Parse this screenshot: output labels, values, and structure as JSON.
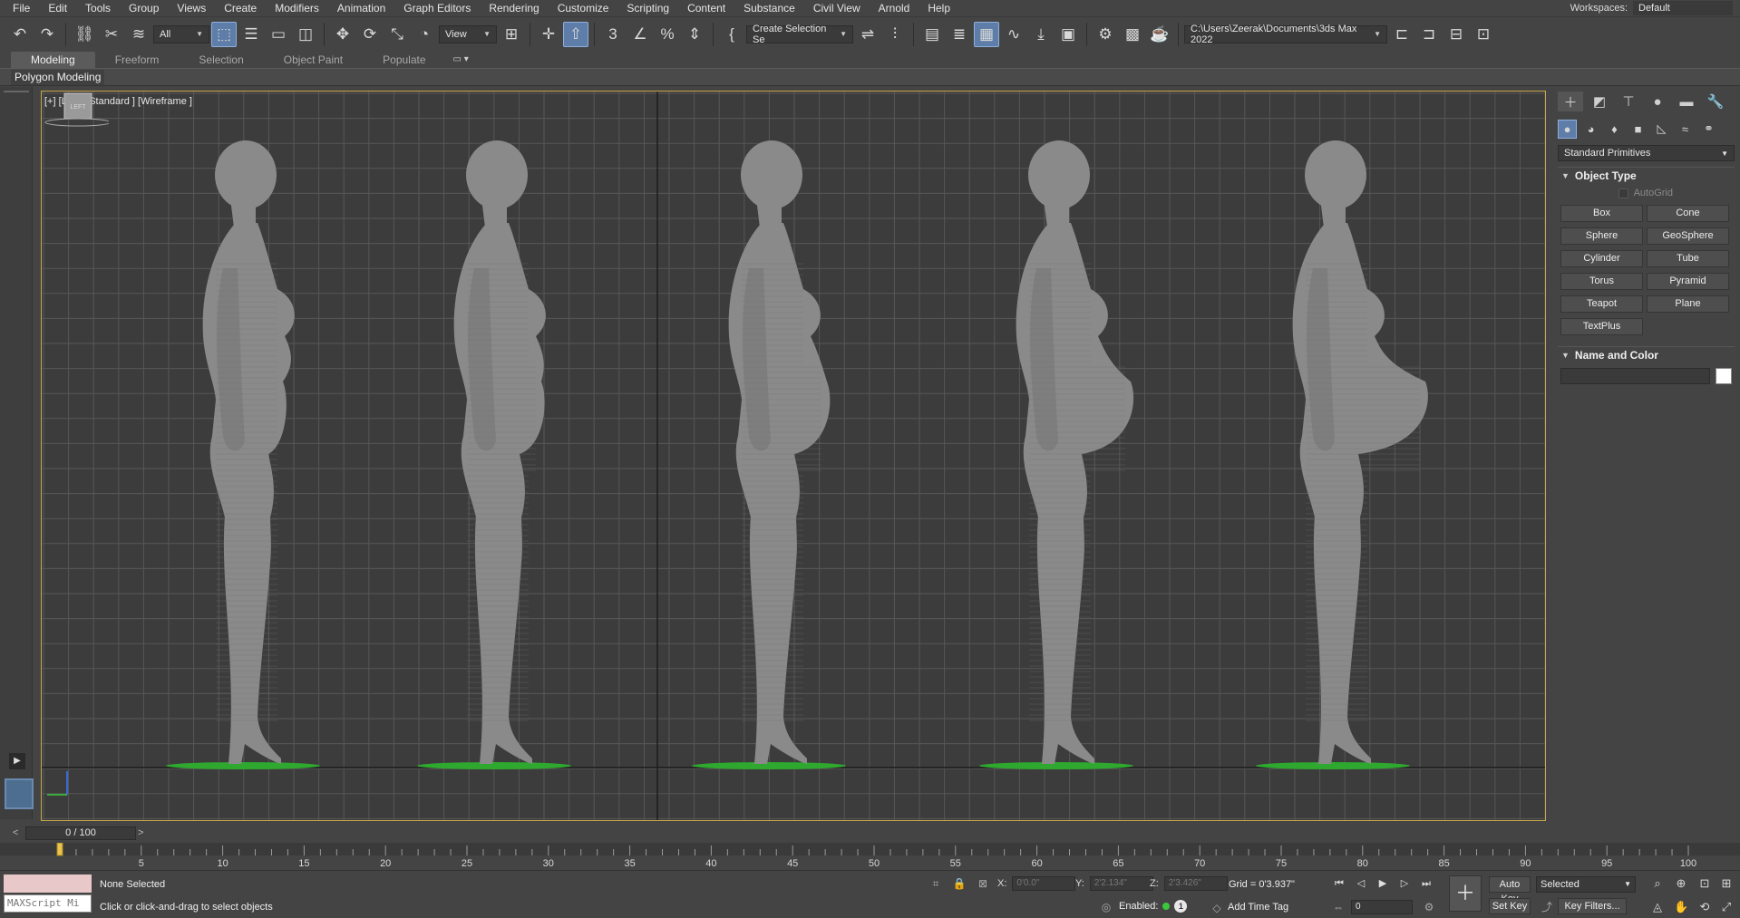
{
  "menu": [
    "File",
    "Edit",
    "Tools",
    "Group",
    "Views",
    "Create",
    "Modifiers",
    "Animation",
    "Graph Editors",
    "Rendering",
    "Customize",
    "Scripting",
    "Content",
    "Substance",
    "Civil View",
    "Arnold",
    "Help"
  ],
  "workspace": {
    "label": "Workspaces:",
    "value": "Default"
  },
  "toolbar": {
    "filter_value": "All",
    "refcoord_value": "View",
    "selection_set_value": "Create Selection Se",
    "project_path": "C:\\Users\\Zeerak\\Documents\\3ds Max 2022"
  },
  "ribbon": {
    "tabs": [
      "Modeling",
      "Freeform",
      "Selection",
      "Object Paint",
      "Populate"
    ],
    "active_tab": "Modeling",
    "panel_label": "Polygon Modeling"
  },
  "viewport": {
    "label": "[+] [Left ] [Standard ] [Wireframe ]",
    "viewcube_face": "LEFT",
    "figure_count": 5
  },
  "command_panel": {
    "category_value": "Standard Primitives",
    "object_type_title": "Object Type",
    "autogrid_label": "AutoGrid",
    "buttons": [
      "Box",
      "Cone",
      "Sphere",
      "GeoSphere",
      "Cylinder",
      "Tube",
      "Torus",
      "Pyramid",
      "Teapot",
      "Plane",
      "TextPlus"
    ],
    "name_color_title": "Name and Color"
  },
  "timeslider": {
    "value": "0 / 100"
  },
  "trackbar": {
    "labels": [
      "5",
      "10",
      "15",
      "20",
      "25",
      "30",
      "35",
      "40",
      "45",
      "50",
      "55",
      "60",
      "65",
      "70",
      "75",
      "80",
      "85",
      "90",
      "95",
      "100"
    ]
  },
  "status": {
    "maxscript_placeholder": "MAXScript Mi",
    "selection": "None Selected",
    "prompt": "Click or click-and-drag to select objects",
    "x_label": "X:",
    "x_value": "0'0.0\"",
    "y_label": "Y:",
    "y_value": "2'2.134\"",
    "z_label": "Z:",
    "z_value": "2'3.426\"",
    "grid": "Grid = 0'3.937\"",
    "enabled": "Enabled:",
    "enabled_badge": "1",
    "add_time_tag": "Add Time Tag",
    "frame_value": "0",
    "auto_key": "Auto Key",
    "set_key": "Set Key",
    "selected_value": "Selected",
    "key_filters": "Key Filters..."
  },
  "colors": {
    "accent": "#5e7da8",
    "viewport_border": "#c8a84a",
    "ground": "#2fa82f",
    "mesh": "#8a8a8a"
  }
}
